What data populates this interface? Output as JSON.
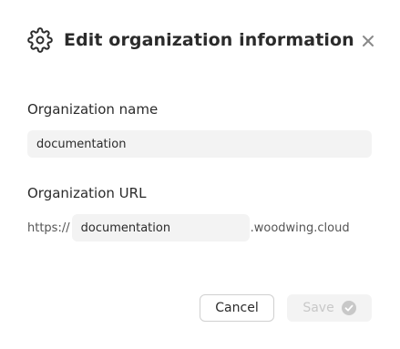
{
  "dialog": {
    "title": "Edit organization information",
    "icons": {
      "header": "gear-icon",
      "close": "close-icon",
      "save": "check-circle-icon"
    }
  },
  "fields": {
    "name": {
      "label": "Organization name",
      "value": "documentation"
    },
    "url": {
      "label": "Organization URL",
      "prefix": "https://",
      "value": "documentation",
      "suffix": ".woodwing.cloud"
    }
  },
  "buttons": {
    "cancel": "Cancel",
    "save": "Save"
  },
  "colors": {
    "input_bg": "#f3f3f3",
    "disabled_text": "#c8c8c8",
    "text": "#2b2b2b"
  }
}
